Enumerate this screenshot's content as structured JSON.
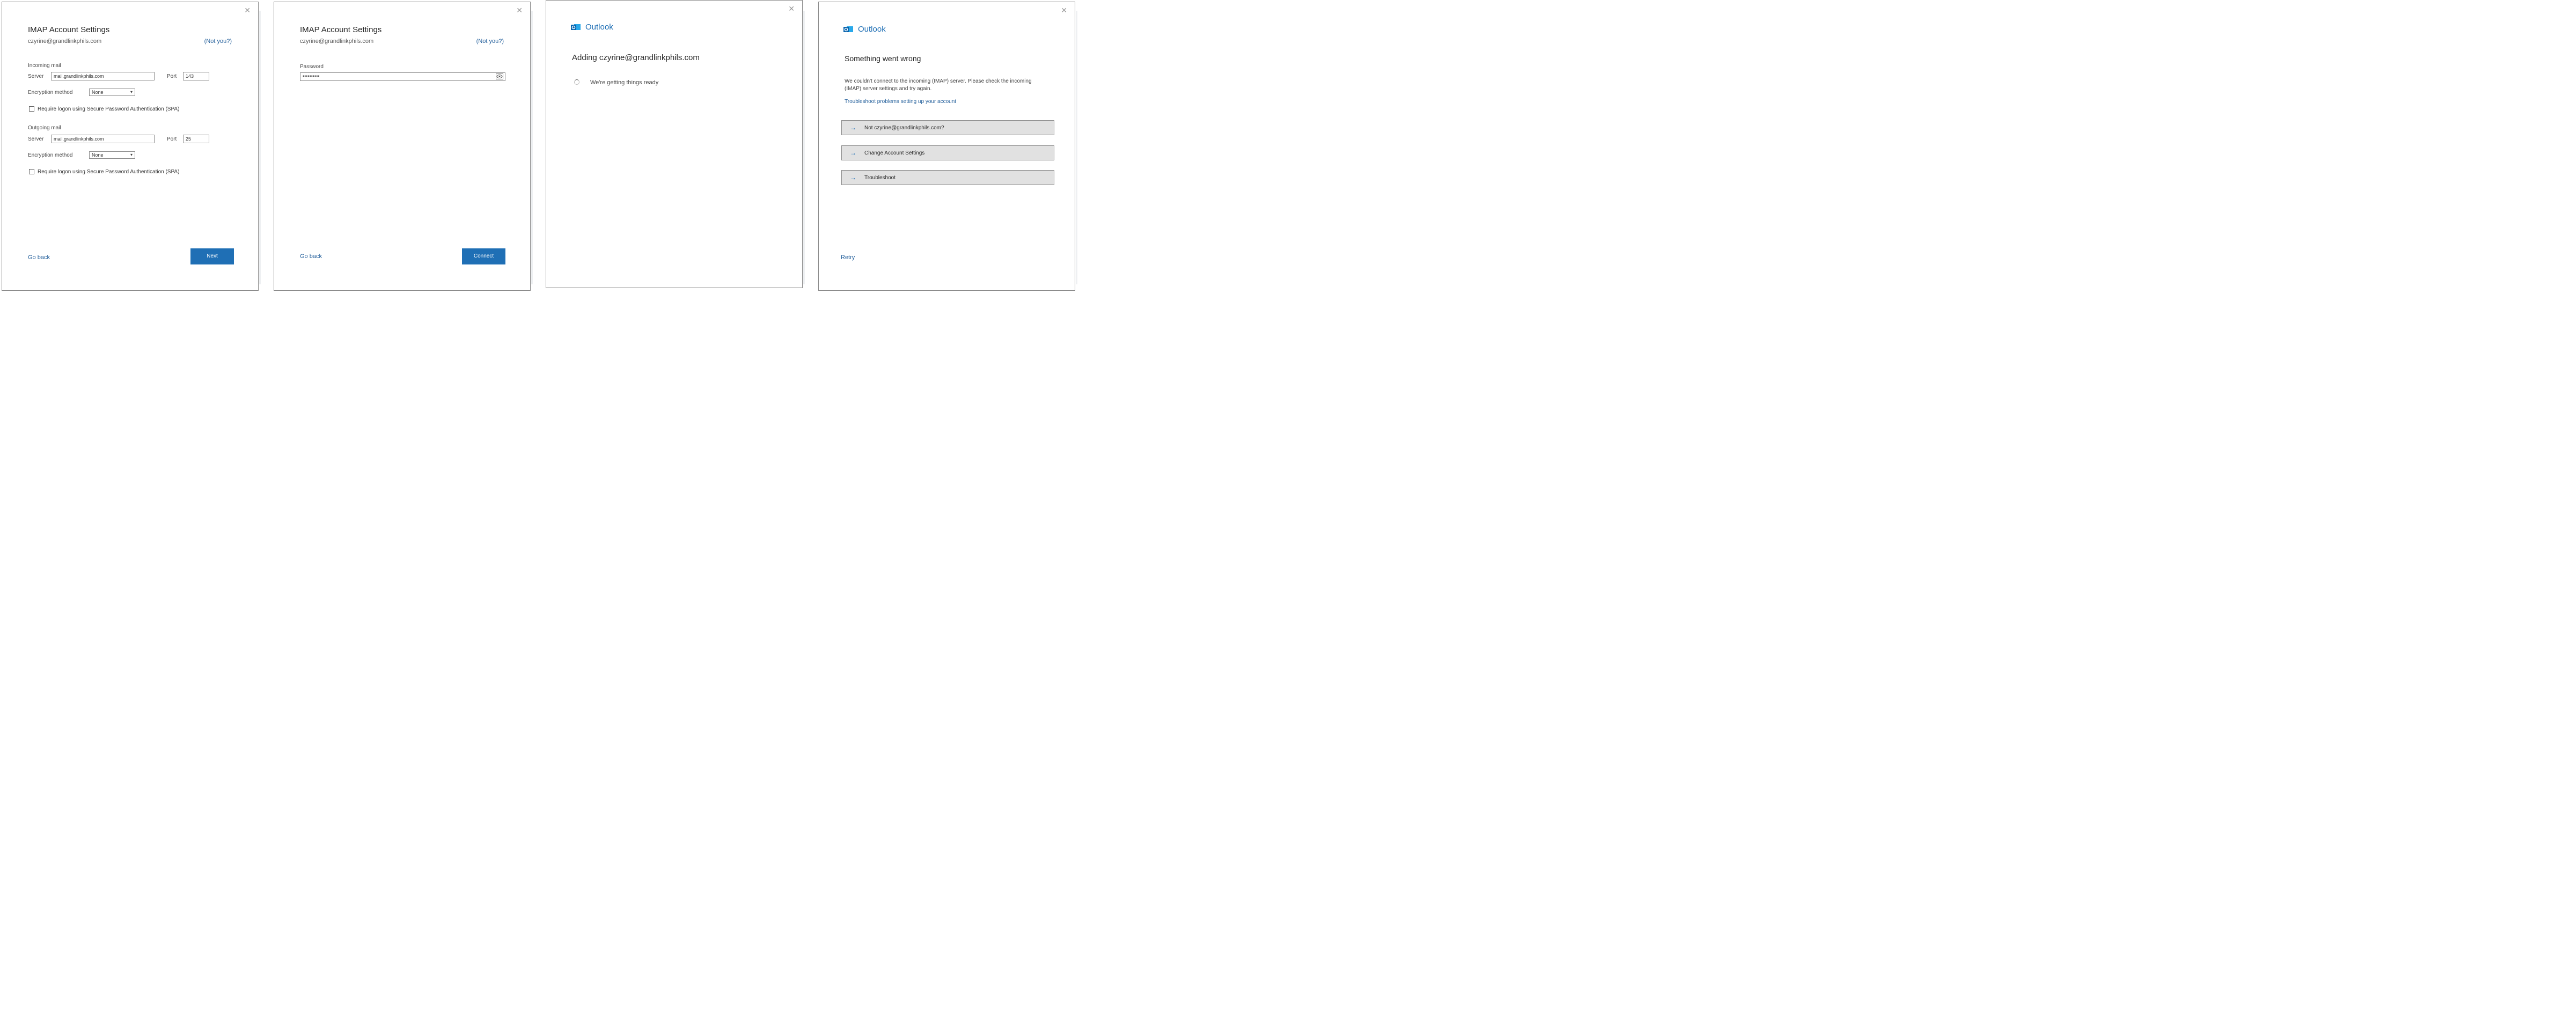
{
  "panel1": {
    "title": "IMAP Account Settings",
    "email": "czyrine@grandlinkphils.com",
    "not_you": "(Not you?)",
    "incoming_heading": "Incoming mail",
    "outgoing_heading": "Outgoing mail",
    "server_label": "Server",
    "port_label": "Port",
    "incoming_server": "mail.grandlinkphils.com",
    "incoming_port": "143",
    "outgoing_server": "mail.grandlinkphils.com",
    "outgoing_port": "25",
    "encryption_label": "Encryption method",
    "encryption_value": "None",
    "spa_label": "Require logon using Secure Password Authentication (SPA)",
    "go_back": "Go back",
    "next": "Next"
  },
  "panel2": {
    "title": "IMAP Account Settings",
    "email": "czyrine@grandlinkphils.com",
    "not_you": "(Not you?)",
    "password_label": "Password",
    "password_value": "••••••••••",
    "go_back": "Go back",
    "connect": "Connect"
  },
  "panel3": {
    "brand": "Outlook",
    "heading": "Adding czyrine@grandlinkphils.com",
    "status": "We're getting things ready"
  },
  "panel4": {
    "brand": "Outlook",
    "heading": "Something went wrong",
    "message": "We couldn't connect to the incoming (IMAP) server. Please check the incoming (IMAP) server settings and try again.",
    "troubleshoot_link": "Troubleshoot problems setting up your account",
    "options": [
      {
        "label": "Not czyrine@grandlinkphils.com?"
      },
      {
        "label": "Change Account Settings"
      },
      {
        "label": "Troubleshoot"
      }
    ],
    "retry": "Retry"
  },
  "colors": {
    "accent": "#1f6fb5",
    "link": "#1f5c99",
    "border": "#8a8a8a"
  }
}
